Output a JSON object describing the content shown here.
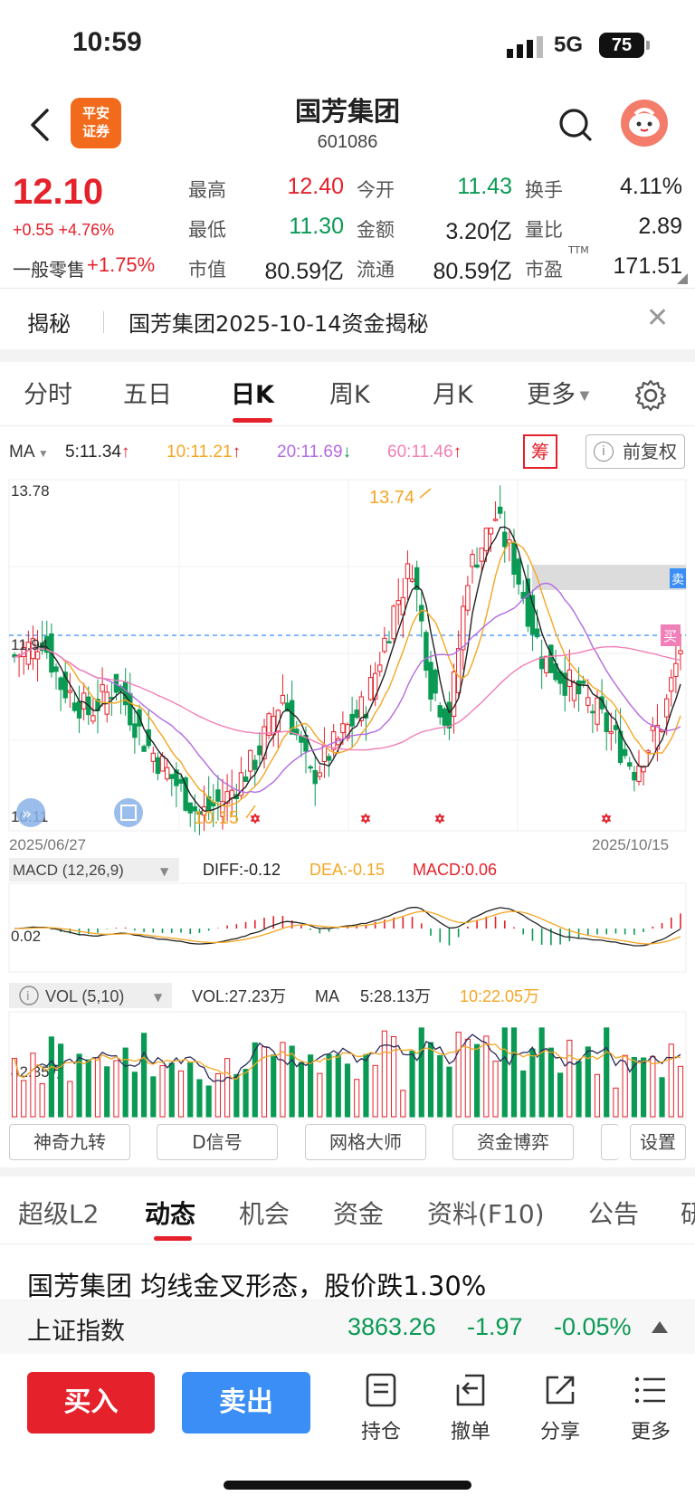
{
  "status_bar": {
    "time": "10:59",
    "network": "5G",
    "battery": "75"
  },
  "header": {
    "title": "国芳集团",
    "code": "601086",
    "logo_text_1": "平安",
    "logo_text_2": "证券"
  },
  "quote": {
    "price": "12.10",
    "change": "+0.55 +4.76%",
    "retail_label": "一般零售",
    "retail_change": "+1.75%",
    "fields": [
      {
        "label": "最高",
        "value": "12.40",
        "color": "red"
      },
      {
        "label": "今开",
        "value": "11.43",
        "color": "green"
      },
      {
        "label": "换手",
        "value": "4.11%",
        "color": "black"
      },
      {
        "label": "最低",
        "value": "11.30",
        "color": "green"
      },
      {
        "label": "金额",
        "value": "3.20亿",
        "color": "black"
      },
      {
        "label": "量比",
        "value": "2.89",
        "color": "black"
      },
      {
        "label": "市值",
        "value": "80.59亿",
        "color": "black"
      },
      {
        "label": "流通",
        "value": "80.59亿",
        "color": "black"
      },
      {
        "label": "市盈",
        "value": "171.51",
        "color": "black"
      }
    ],
    "pe_sup": "TTM"
  },
  "reveal": {
    "label": "揭秘",
    "text": "国芳集团2025-10-14资金揭秘"
  },
  "period_tabs": [
    {
      "label": "分时"
    },
    {
      "label": "五日"
    },
    {
      "label": "日K"
    },
    {
      "label": "周K"
    },
    {
      "label": "月K"
    },
    {
      "label": "更多"
    }
  ],
  "ma_legend": {
    "label": "MA",
    "items": [
      {
        "text": "5:11.34",
        "color": "#222222",
        "arrow": "↑"
      },
      {
        "text": "10:11.21",
        "color": "#f5a623",
        "arrow": "↑"
      },
      {
        "text": "20:11.69",
        "color": "#b36ae2",
        "arrow": "↓"
      },
      {
        "text": "60:11.46",
        "color": "#f17fb8",
        "arrow": "↑"
      }
    ],
    "chou": "筹",
    "fuquan": "前复权"
  },
  "kline": {
    "y_max_label": "13.78",
    "y_mid_label": "11.94",
    "y_min_label": "10.11",
    "high_marker": "13.74",
    "low_marker": "10.15",
    "date_start": "2025/06/27",
    "date_end": "2025/10/15",
    "sell_tag": "卖",
    "buy_tag": "买"
  },
  "macd": {
    "title": "MACD (12,26,9)",
    "diff": "DIFF:-0.12",
    "dea": "DEA:-0.15",
    "macd": "MACD:0.06",
    "axis_label": "0.02"
  },
  "vol": {
    "title": "VOL (5,10)",
    "vol": "VOL:27.23万",
    "ma5_label": "MA",
    "ma5": "5:28.13万",
    "ma10": "10:22.05万",
    "axis_label": "42.85万"
  },
  "tools": [
    "神奇九转",
    "D信号",
    "网格大师",
    "资金博弈",
    "设置"
  ],
  "content_tabs": [
    "超级L2",
    "动态",
    "机会",
    "资金",
    "资料(F10)",
    "公告",
    "研"
  ],
  "news_headline": "国芳集团 均线金叉形态，股价跌1.30%",
  "index": {
    "name": "上证指数",
    "value": "3863.26",
    "change": "-1.97",
    "pct": "-0.05%"
  },
  "bottom": {
    "buy": "买入",
    "sell": "卖出",
    "actions": [
      "持仓",
      "撤单",
      "分享",
      "更多"
    ]
  },
  "colors": {
    "up": "#e5212b",
    "down": "#0a9a54",
    "accent_blue": "#3a8ef6",
    "brand_orange": "#f26a1b"
  }
}
